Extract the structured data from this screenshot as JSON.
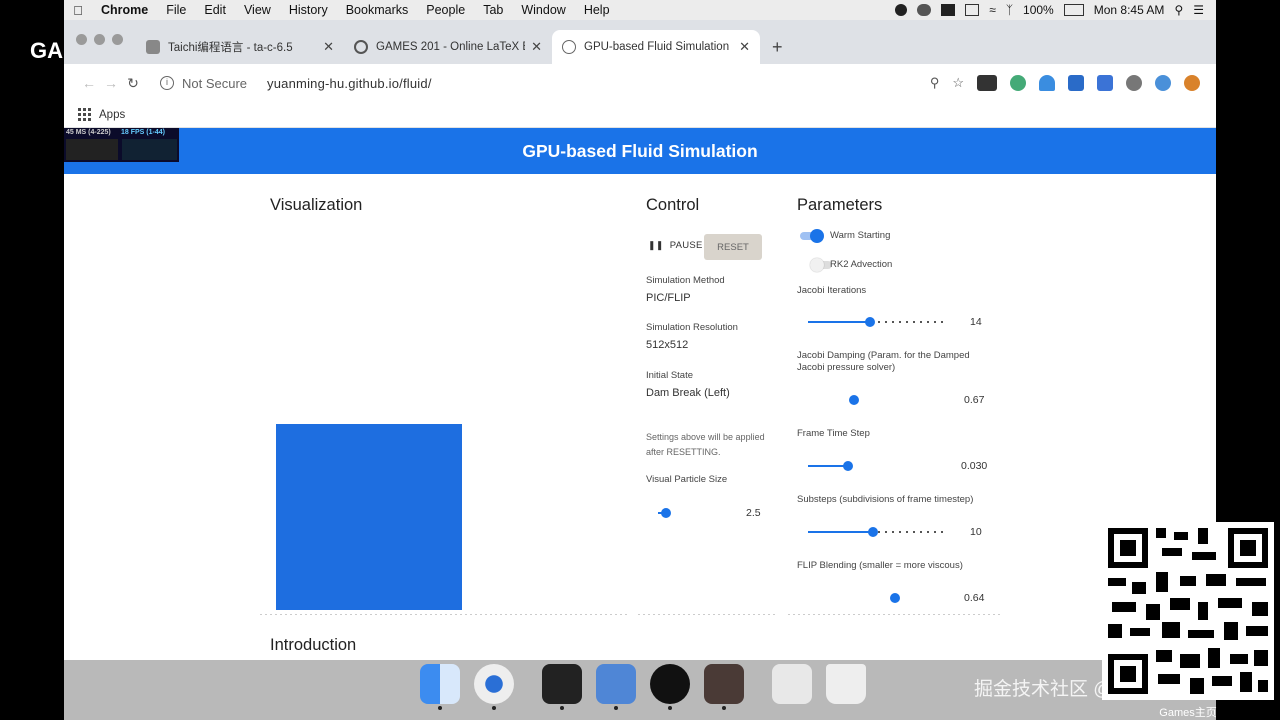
{
  "menubar": {
    "app": "Chrome",
    "items": [
      "File",
      "Edit",
      "View",
      "History",
      "Bookmarks",
      "People",
      "Tab",
      "Window",
      "Help"
    ],
    "battery": "100%",
    "clock": "Mon 8:45 AM"
  },
  "side_text": "GA",
  "browser": {
    "tabs": [
      {
        "title": "Taichi编程语言 - ta-c-6.5",
        "active": false
      },
      {
        "title": "GAMES 201 - Online LaTeX E",
        "active": false
      },
      {
        "title": "GPU-based Fluid Simulation",
        "active": true
      }
    ],
    "new_tab": "+",
    "security": "Not Secure",
    "url": "yuanming-hu.github.io/fluid/",
    "bookmarks": {
      "apps": "Apps"
    }
  },
  "page": {
    "title": "GPU-based Fluid Simulation",
    "stats": {
      "ms": "45 MS (4-225)",
      "fps": "18 FPS (1-44)"
    },
    "visualization": {
      "heading": "Visualization"
    },
    "control": {
      "heading": "Control",
      "pause_label": "PAUSE",
      "reset_label": "RESET",
      "method_label": "Simulation Method",
      "method_value": "PIC/FLIP",
      "resolution_label": "Simulation Resolution",
      "resolution_value": "512x512",
      "initial_label": "Initial State",
      "initial_value": "Dam Break (Left)",
      "note": "Settings above will be applied after RESETTING.",
      "particle_label": "Visual Particle Size",
      "particle_value": "2.5",
      "particle_fraction": 0.1
    },
    "parameters": {
      "heading": "Parameters",
      "warm_starting": {
        "label": "Warm Starting",
        "on": true
      },
      "rk2": {
        "label": "RK2 Advection",
        "on": false
      },
      "jacobi_iterations": {
        "label": "Jacobi Iterations",
        "value": "14",
        "fraction": 0.45
      },
      "jacobi_damping": {
        "label": "Jacobi Damping (Param. for the Damped Jacobi pressure solver)",
        "value": "0.67",
        "fraction": 0.33
      },
      "frame_time_step": {
        "label": "Frame Time Step",
        "value": "0.030",
        "fraction": 0.29
      },
      "substeps": {
        "label": "Substeps (subdivisions of frame timestep)",
        "value": "10",
        "fraction": 0.47
      },
      "flip_blending": {
        "label": "FLIP Blending (smaller = more viscous)",
        "value": "0.64",
        "fraction": 0.63
      }
    },
    "introduction": {
      "heading": "Introduction"
    }
  },
  "overlay": {
    "watermark": "掘金技术社区 @ 布客飞龙",
    "qr_caption": "Games主页"
  },
  "colors": {
    "accent": "#1a73e8",
    "sim_fluid": "#1e6ee0",
    "dock": "#b9b9b9"
  }
}
